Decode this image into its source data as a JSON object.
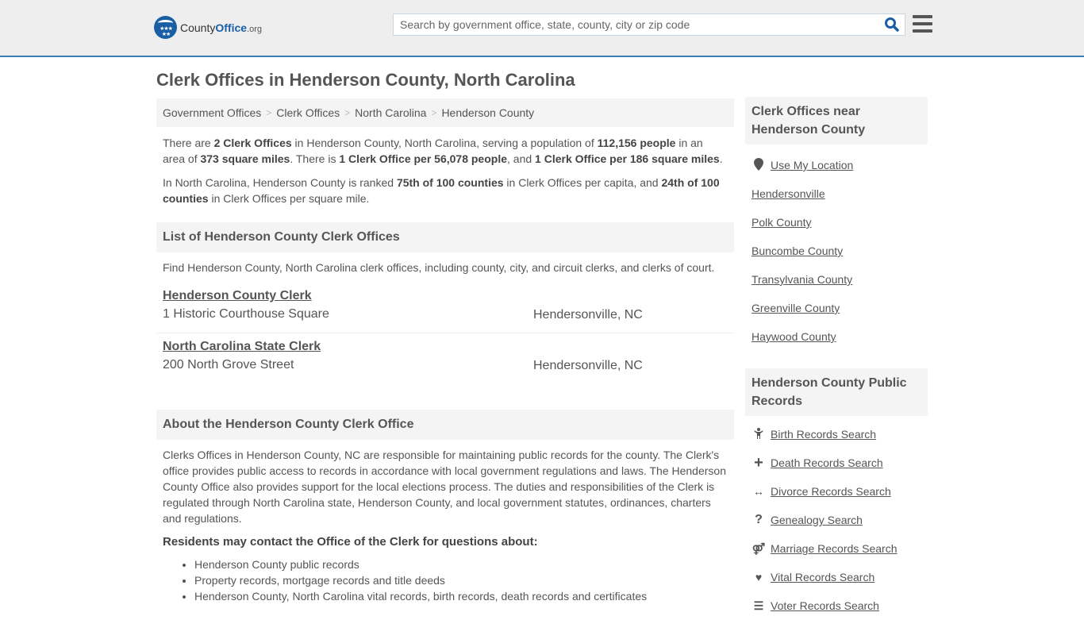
{
  "header": {
    "logo": {
      "name": "County",
      "brand": "Office",
      "tld": ".org"
    },
    "search_placeholder": "Search by government office, state, county, city or zip code"
  },
  "page_title": "Clerk Offices in Henderson County, North Carolina",
  "breadcrumb": [
    "Government Offices",
    "Clerk Offices",
    "North Carolina",
    "Henderson County"
  ],
  "summary": {
    "p1": [
      {
        "t": "There are ",
        "b": false
      },
      {
        "t": "2 Clerk Offices",
        "b": true
      },
      {
        "t": " in Henderson County, North Carolina, serving a population of ",
        "b": false
      },
      {
        "t": "112,156 people",
        "b": true
      },
      {
        "t": " in an area of ",
        "b": false
      },
      {
        "t": "373 square miles",
        "b": true
      },
      {
        "t": ". There is ",
        "b": false
      },
      {
        "t": "1 Clerk Office per 56,078 people",
        "b": true
      },
      {
        "t": ", and ",
        "b": false
      },
      {
        "t": "1 Clerk Office per 186 square miles",
        "b": true
      },
      {
        "t": ".",
        "b": false
      }
    ],
    "p2": [
      {
        "t": "In North Carolina, Henderson County is ranked ",
        "b": false
      },
      {
        "t": "75th of 100 counties",
        "b": true
      },
      {
        "t": " in Clerk Offices per capita, and ",
        "b": false
      },
      {
        "t": "24th of 100 counties",
        "b": true
      },
      {
        "t": " in Clerk Offices per square mile.",
        "b": false
      }
    ]
  },
  "list_section": {
    "title": "List of Henderson County Clerk Offices",
    "intro": "Find Henderson County, North Carolina clerk offices, including county, city, and circuit clerks, and clerks of court.",
    "offices": [
      {
        "name": "Henderson County Clerk",
        "address": "1 Historic Courthouse Square",
        "city": "Hendersonville, NC"
      },
      {
        "name": "North Carolina State Clerk",
        "address": "200 North Grove Street",
        "city": "Hendersonville, NC"
      }
    ]
  },
  "about_section": {
    "title": "About the Henderson County Clerk Office",
    "text": "Clerks Offices in Henderson County, NC are responsible for maintaining public records for the county. The Clerk's office provides public access to records in accordance with local government regulations and laws. The Henderson County Office also provides support for the local elections process. The duties and responsibilities of the Clerk is regulated through North Carolina state, Henderson County, and local government statutes, ordinances, charters and regulations.",
    "questions_heading": "Residents may contact the Office of the Clerk for questions about:",
    "questions": [
      "Henderson County public records",
      "Property records, mortgage records and title deeds",
      "Henderson County, North Carolina vital records, birth records, death records and certificates"
    ]
  },
  "sidebar": {
    "nearby": {
      "title": "Clerk Offices near Henderson County",
      "use_location": "Use My Location",
      "links": [
        "Hendersonville",
        "Polk County",
        "Buncombe County",
        "Transylvania County",
        "Greenville County",
        "Haywood County"
      ]
    },
    "records": {
      "title": "Henderson County Public Records",
      "links": [
        {
          "icon": "child-icon",
          "glyph": "🯅",
          "label": "Birth Records Search"
        },
        {
          "icon": "cross-icon",
          "glyph": "+",
          "label": "Death Records Search"
        },
        {
          "icon": "arrows-horizontal-icon",
          "glyph": "↔",
          "label": "Divorce Records Search"
        },
        {
          "icon": "question-icon",
          "glyph": "?",
          "label": "Genealogy Search"
        },
        {
          "icon": "venus-mars-icon",
          "glyph": "⚤",
          "label": "Marriage Records Search"
        },
        {
          "icon": "heartbeat-icon",
          "glyph": "♥",
          "label": "Vital Records Search"
        },
        {
          "icon": "list-ol-icon",
          "glyph": "☰",
          "label": "Voter Records Search"
        }
      ]
    }
  }
}
